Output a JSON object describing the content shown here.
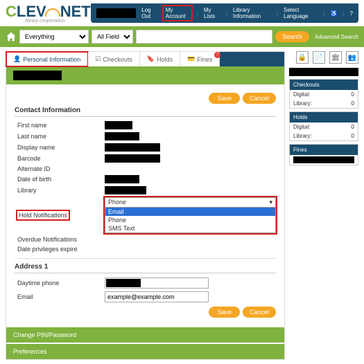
{
  "brand": {
    "tagline": "library cooperation"
  },
  "topnav": {
    "logout": "Log Out",
    "my_account": "My Account",
    "my_lists": "My Lists",
    "library_info": "Library Information",
    "select_lang": "Select Language"
  },
  "search": {
    "scope": "Everything",
    "fields": "All Fields",
    "query": "",
    "button": "Search",
    "advanced": "Advanced Search"
  },
  "tabs": {
    "personal": "Personal Information",
    "checkouts": "Checkouts",
    "holds": "Holds",
    "fines": "Fines"
  },
  "contact": {
    "section": "Contact Information",
    "save": "Save",
    "cancel": "Cancel",
    "first_name": "First name",
    "last_name": "Last name",
    "display_name": "Display name",
    "barcode": "Barcode",
    "alternate_id": "Alternate ID",
    "dob": "Date of birth",
    "library": "Library",
    "hold_notif": "Hold Notifications",
    "overdue_notif": "Overdue Notifications",
    "date_priv": "Date privileges expire",
    "dropdown_selected": "Phone",
    "dropdown_options": {
      "email": "Email",
      "phone": "Phone",
      "sms": "SMS Text"
    }
  },
  "address": {
    "section": "Address 1",
    "daytime_phone": "Daytime phone",
    "email": "Email",
    "email_value": "example@example.com"
  },
  "bottom": {
    "change_pin": "Change PIN/Password",
    "preferences": "Preferences"
  },
  "sidebar": {
    "checkouts": "Checkouts",
    "holds": "Holds",
    "fines": "Fines",
    "digital": "Digital:",
    "library": "Library:",
    "zero": "0"
  }
}
